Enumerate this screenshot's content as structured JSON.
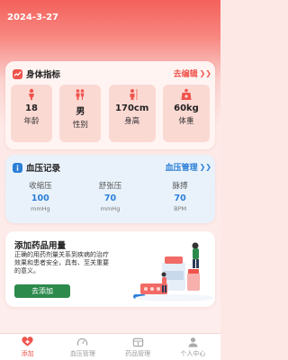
{
  "header": {
    "date": "2024-3-27"
  },
  "body_card": {
    "title": "身体指标",
    "edit_label": "去编辑",
    "metrics": [
      {
        "value": "18",
        "label": "年龄",
        "icon": "person-icon"
      },
      {
        "value": "男",
        "label": "性别",
        "icon": "gender-icon"
      },
      {
        "value": "170cm",
        "label": "身高",
        "icon": "height-icon"
      },
      {
        "value": "60kg",
        "label": "体重",
        "icon": "weight-icon"
      }
    ]
  },
  "bp_card": {
    "title": "血压记录",
    "manage_label": "血压管理",
    "columns": [
      {
        "label": "收缩压",
        "value": "100",
        "unit": "mmHg"
      },
      {
        "label": "舒张压",
        "value": "70",
        "unit": "mmHg"
      },
      {
        "label": "脉搏",
        "value": "70",
        "unit": "BPM"
      }
    ]
  },
  "med_card": {
    "title": "添加药品用量",
    "description": "正确的用药剂量关系到疾病的治疗效果和患者安全，具有、至关重要的意义。",
    "button_label": "去添加"
  },
  "tabbar": {
    "items": [
      {
        "label": "添加",
        "icon": "heart-plus-icon",
        "active": true
      },
      {
        "label": "血压管理",
        "icon": "gauge-icon",
        "active": false
      },
      {
        "label": "药品管理",
        "icon": "medicine-box-icon",
        "active": false
      },
      {
        "label": "个人中心",
        "icon": "user-icon",
        "active": false
      }
    ]
  },
  "colors": {
    "primary": "#f0544d",
    "blue": "#2b7fd6",
    "green": "#2d8a4d"
  }
}
